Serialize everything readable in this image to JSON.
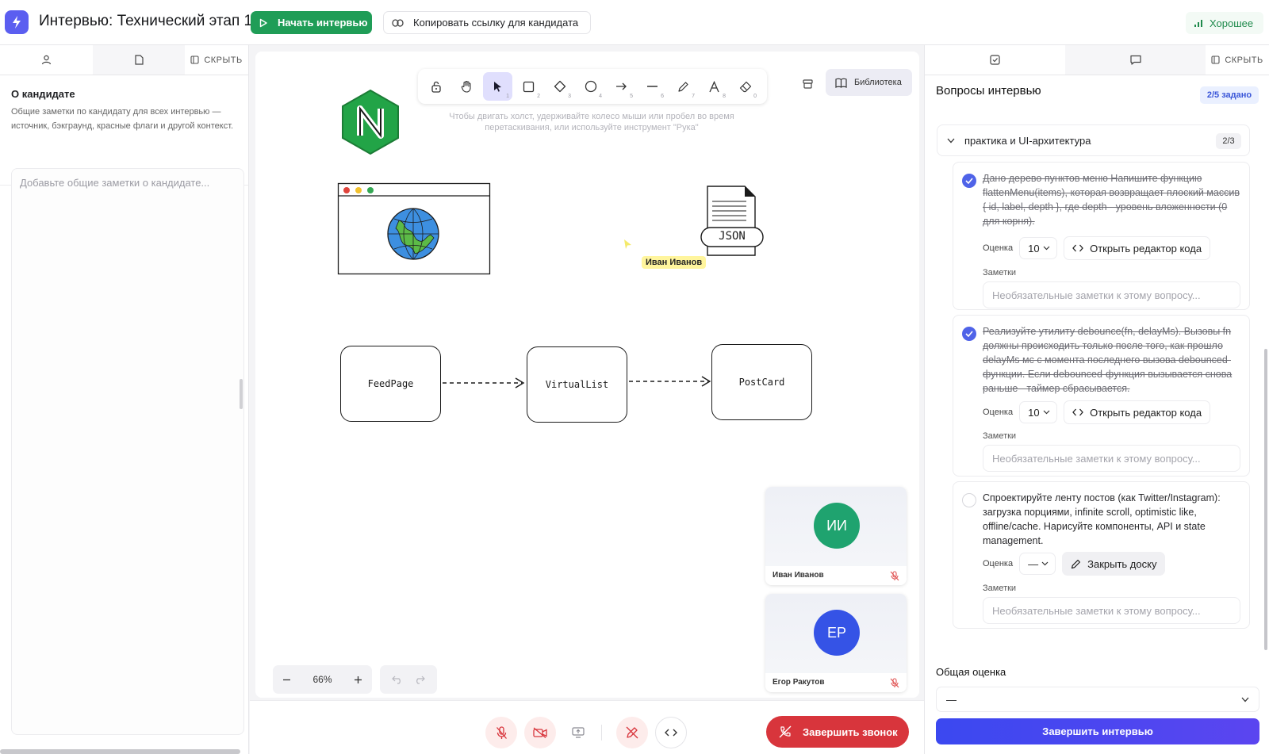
{
  "header": {
    "title": "Интервью: Технический этап 1",
    "start_label": "Начать интервью",
    "copy_label": "Копировать ссылку для кандидата",
    "connection_label": "Хорошее"
  },
  "left": {
    "hide_label": "СКРЫТЬ",
    "about_title": "О кандидате",
    "about_desc": "Общие заметки по кандидату для всех интервью — источник, бэкграунд, красные флаги и другой контекст.",
    "notes_placeholder": "Добавьте общие заметки о кандидате..."
  },
  "canvas": {
    "tools": [
      {
        "icon": "lock-icon",
        "key": ""
      },
      {
        "icon": "hand-icon",
        "key": ""
      },
      {
        "icon": "pointer-icon",
        "key": "1"
      },
      {
        "icon": "rectangle-icon",
        "key": "2"
      },
      {
        "icon": "diamond-icon",
        "key": "3"
      },
      {
        "icon": "ellipse-icon",
        "key": "4"
      },
      {
        "icon": "arrow-icon",
        "key": "5"
      },
      {
        "icon": "line-icon",
        "key": "6"
      },
      {
        "icon": "pencil-icon",
        "key": "7"
      },
      {
        "icon": "text-icon",
        "key": "8"
      },
      {
        "icon": "eraser-icon",
        "key": "0"
      }
    ],
    "hint": "Чтобы двигать холст, удерживайте колесо мыши или пробел во время перетаскивания, или используйте инструмент \"Рука\"",
    "library_label": "Библиотека",
    "cursor_user": "Иван Иванов",
    "json_label": "JSON",
    "nodes": [
      "FeedPage",
      "VirtualList",
      "PostCard"
    ],
    "zoom": "66%"
  },
  "participants": [
    {
      "initials": "ИИ",
      "name": "Иван Иванов",
      "color": "#1fa36f"
    },
    {
      "initials": "ЕР",
      "name": "Егор Ракутов",
      "color": "#3553e6"
    }
  ],
  "callbar": {
    "end_label": "Завершить звонок"
  },
  "right": {
    "hide_label": "СКРЫТЬ",
    "title": "Вопросы интервью",
    "progress": "2/5 задано",
    "section_title": "практика и UI-архитектура",
    "section_count": "2/3",
    "score_label": "Оценка",
    "notes_label": "Заметки",
    "notes_placeholder": "Необязательные заметки к этому вопросу...",
    "questions": [
      {
        "text": "Дано дерево пунктов меню Напишите функцию flattenMenu(items), которая возвращает плоский массив { id, label, depth }, где depth - уровень вложенности (0 для корня).",
        "score": "10",
        "action": "Открыть редактор кода"
      },
      {
        "text": "Реализуйте утилиту debounce(fn, delayMs). Вызовы fn должны происходить только после того, как прошло delayMs мс с момента последнего вызова debounced-функции. Если debounced-функция вызывается снова раньше - таймер сбрасывается.",
        "score": "10",
        "action": "Открыть редактор кода"
      },
      {
        "text": "Спроектируйте ленту постов (как Twitter/Instagram): загрузка порциями, infinite scroll, optimistic like, offline/cache. Нарисуйте компоненты, API и state management.",
        "score": "—",
        "action": "Закрыть доску"
      }
    ],
    "overall_label": "Общая оценка",
    "overall_value": "—",
    "finish_label": "Завершить интервью"
  }
}
